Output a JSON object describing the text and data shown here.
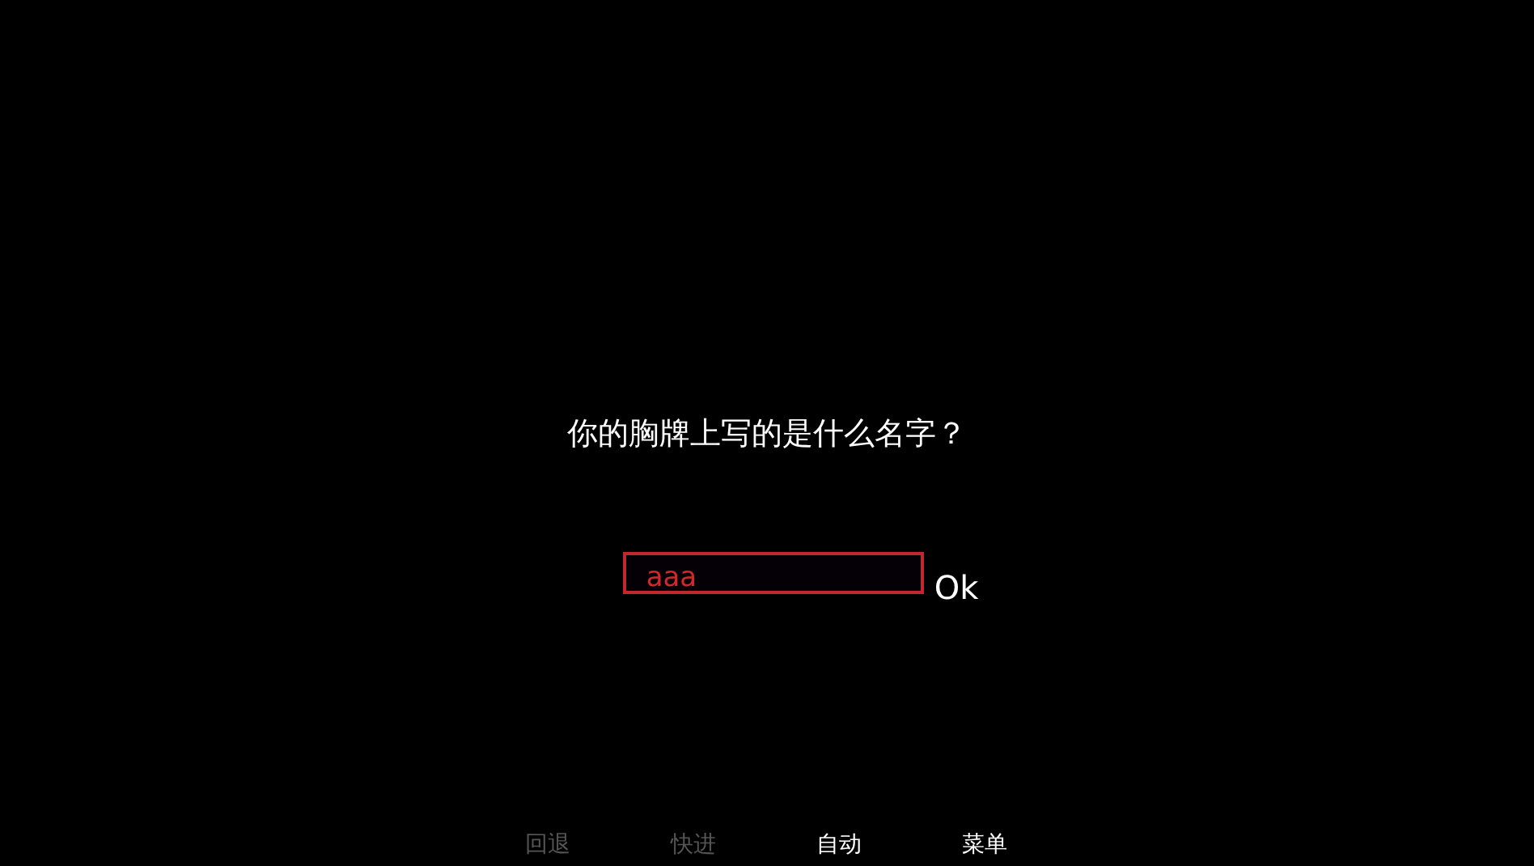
{
  "prompt": {
    "question": "你的胸牌上写的是什么名字？"
  },
  "name_input": {
    "value": "aaa"
  },
  "ok_button": {
    "label": "Ok"
  },
  "quick_menu": [
    {
      "label": "回退",
      "disabled": true
    },
    {
      "label": "快进",
      "disabled": true
    },
    {
      "label": "自动",
      "disabled": false
    },
    {
      "label": "菜单",
      "disabled": false
    }
  ]
}
